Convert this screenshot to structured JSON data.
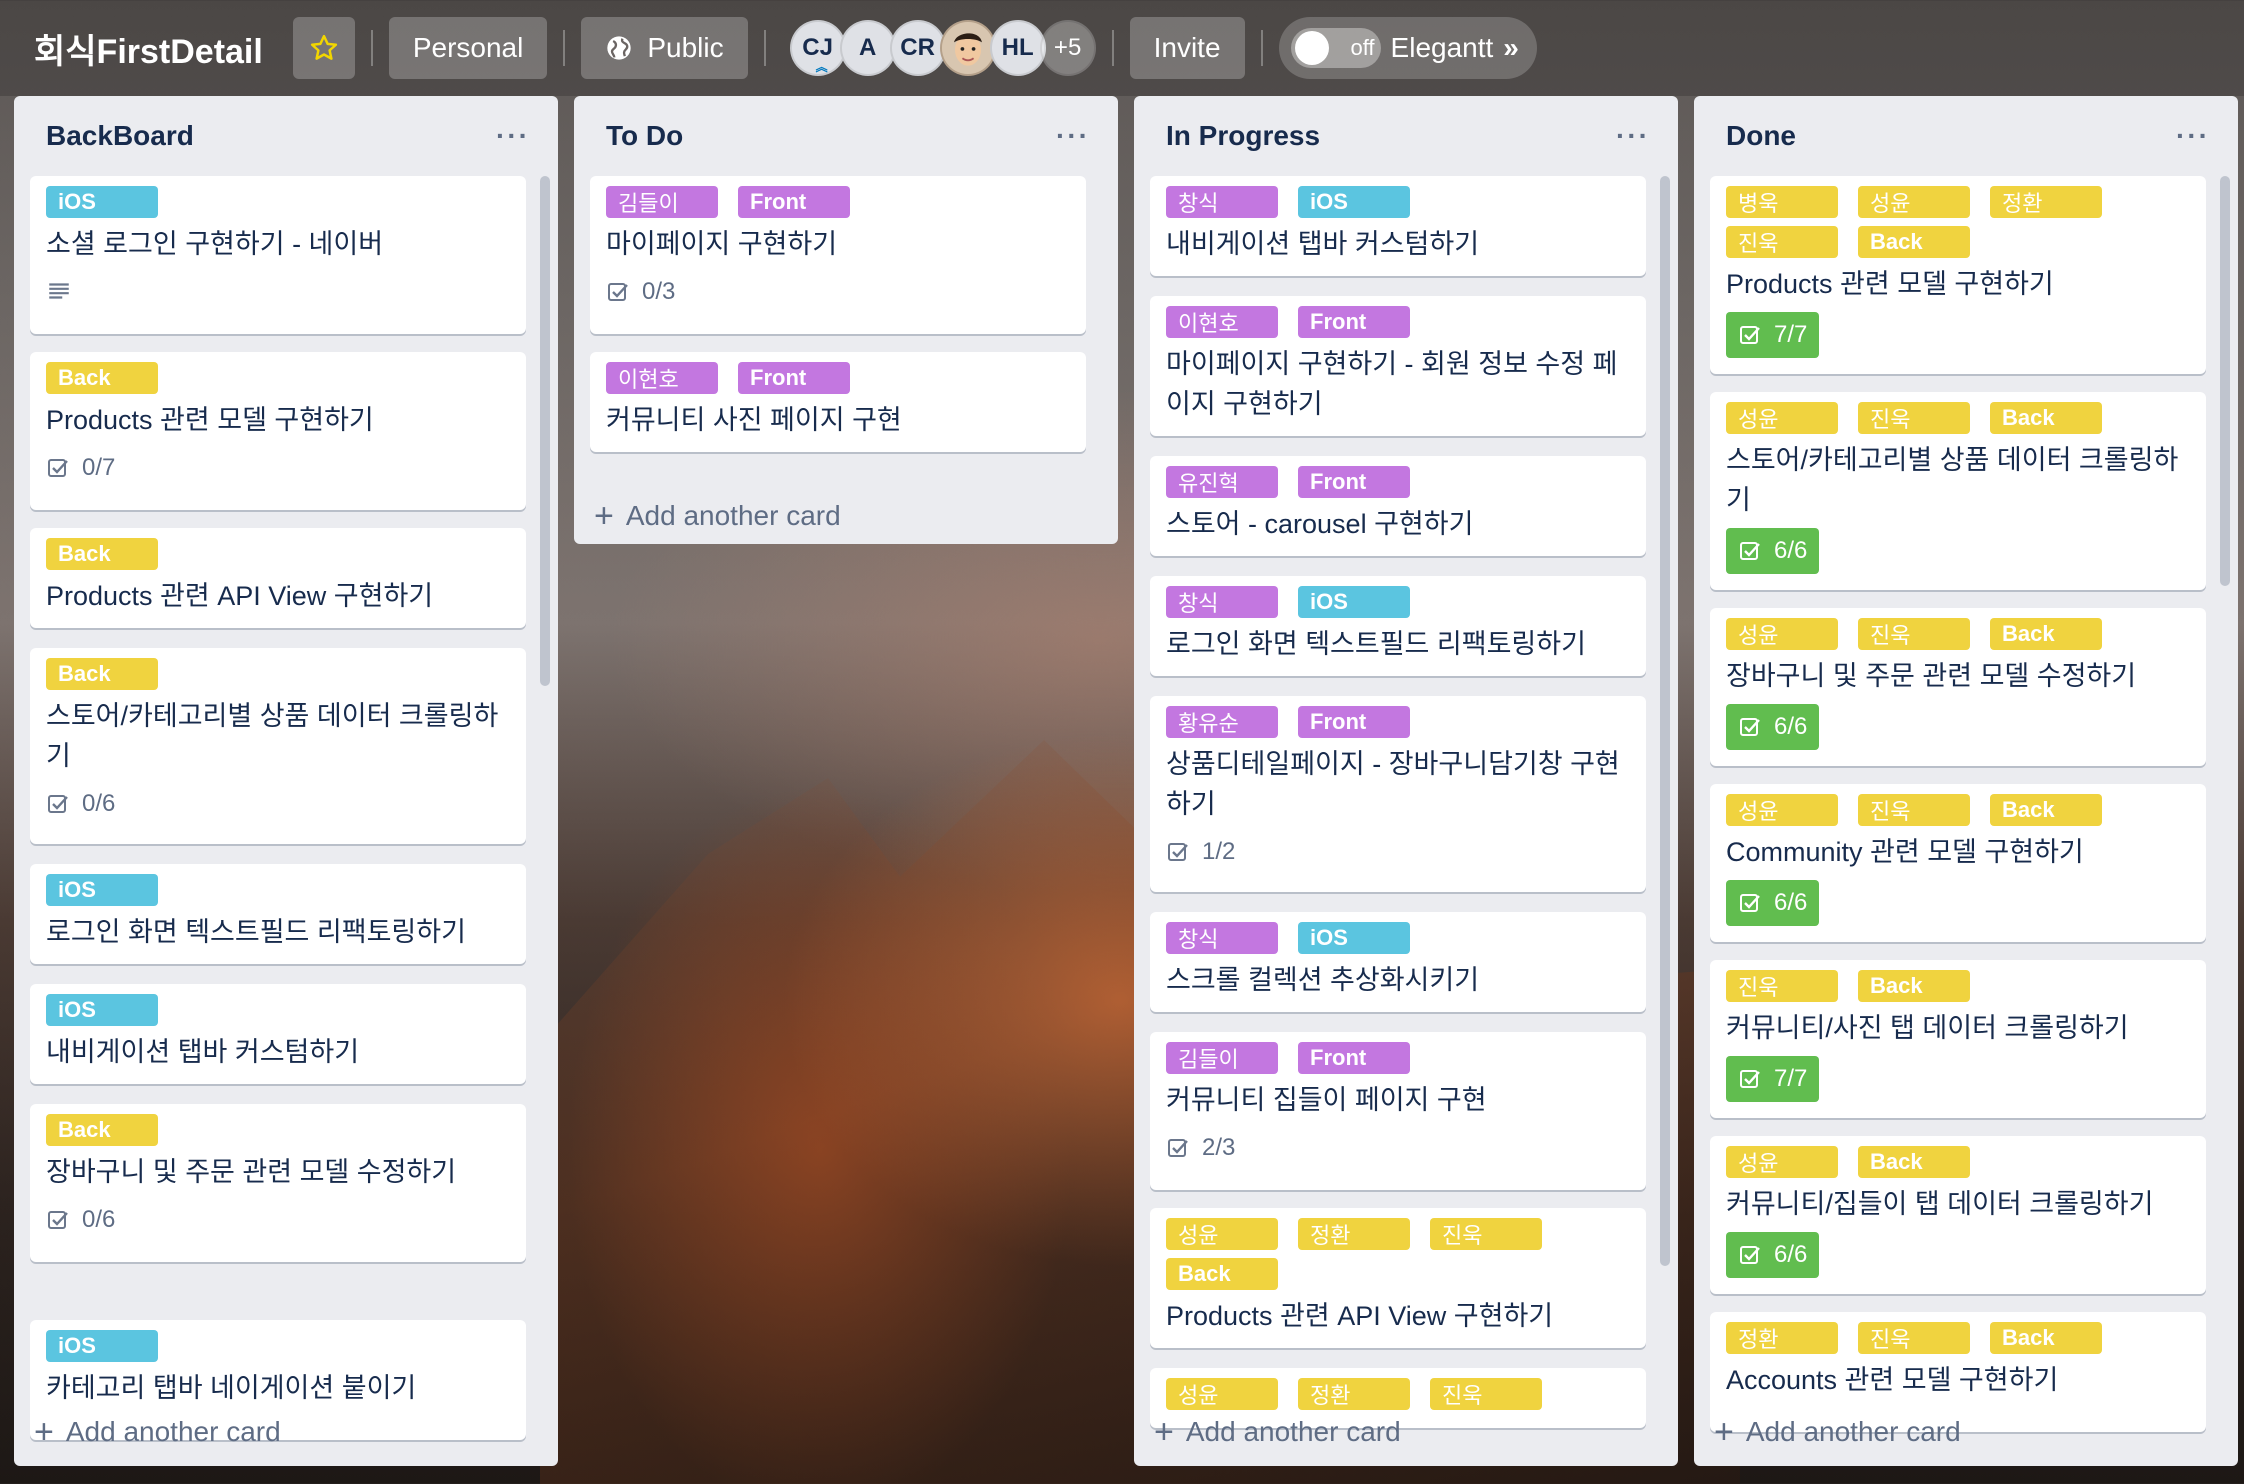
{
  "header": {
    "title": "회식FirstDetail",
    "personal_label": "Personal",
    "public_label": "Public",
    "members": [
      "CJ",
      "A",
      "CR",
      "HL"
    ],
    "members_more": "+5",
    "invite_label": "Invite",
    "toggle_state": "off",
    "powerup_label": "Elegantt",
    "chevron": "»"
  },
  "add_card_label": "Add another card",
  "lists": [
    {
      "title": "BackBoard",
      "cards": [
        {
          "labels": [
            "iOS"
          ],
          "title": "소셜 로그인 구현하기 - 네이버",
          "description_icon": true
        },
        {
          "labels": [
            "Back"
          ],
          "title": "Products 관련 모델 구현하기",
          "checklist": "0/7"
        },
        {
          "labels": [
            "Back"
          ],
          "title": "Products 관련 API View 구현하기"
        },
        {
          "labels": [
            "Back"
          ],
          "title": "스토어/카테고리별 상품 데이터 크롤링하기",
          "checklist": "0/6"
        },
        {
          "labels": [
            "iOS"
          ],
          "title": "로그인 화면 텍스트필드 리팩토링하기"
        },
        {
          "labels": [
            "iOS"
          ],
          "title": "내비게이션 탭바 커스텀하기"
        },
        {
          "labels": [
            "Back"
          ],
          "title": "장바구니 및 주문 관련 모델 수정하기",
          "checklist": "0/6"
        },
        {
          "labels": [
            "iOS"
          ],
          "title": "카테고리 탭바 네이게이션 붙이기"
        }
      ]
    },
    {
      "title": "To Do",
      "cards": [
        {
          "labels": [
            "김들이",
            "Front"
          ],
          "title": "마이페이지 구현하기",
          "checklist": "0/3"
        },
        {
          "labels": [
            "이현호",
            "Front"
          ],
          "title": "커뮤니티 사진 페이지 구현"
        }
      ]
    },
    {
      "title": "In Progress",
      "cards": [
        {
          "labels": [
            "창식",
            "iOS"
          ],
          "title": "내비게이션 탭바 커스텀하기"
        },
        {
          "labels": [
            "이현호",
            "Front"
          ],
          "title": "마이페이지 구현하기 - 회원 정보 수정 페이지 구현하기"
        },
        {
          "labels": [
            "유진혁",
            "Front"
          ],
          "title": "스토어 - carousel 구현하기"
        },
        {
          "labels": [
            "창식",
            "iOS"
          ],
          "title": "로그인 화면 텍스트필드 리팩토링하기"
        },
        {
          "labels": [
            "황유순",
            "Front"
          ],
          "title": "상품디테일페이지 - 장바구니담기창 구현하기",
          "checklist": "1/2"
        },
        {
          "labels": [
            "창식",
            "iOS"
          ],
          "title": "스크롤 컬렉션 추상화시키기"
        },
        {
          "labels": [
            "김들이",
            "Front"
          ],
          "title": "커뮤니티 집들이 페이지 구현",
          "checklist": "2/3"
        },
        {
          "labels": [
            "성윤",
            "정환",
            "진욱",
            "Back"
          ],
          "title": "Products 관련 API View 구현하기"
        },
        {
          "labels": [
            "성윤",
            "정환",
            "진욱"
          ],
          "title": ""
        }
      ]
    },
    {
      "title": "Done",
      "cards": [
        {
          "labels": [
            "병욱",
            "성윤",
            "정환",
            "진욱",
            "Back"
          ],
          "title": "Products 관련 모델 구현하기",
          "checklist": "7/7"
        },
        {
          "labels": [
            "성윤",
            "진욱",
            "Back"
          ],
          "title": "스토어/카테고리별 상품 데이터 크롤링하기",
          "checklist": "6/6"
        },
        {
          "labels": [
            "성윤",
            "진욱",
            "Back"
          ],
          "title": "장바구니 및 주문 관련 모델 수정하기",
          "checklist": "6/6"
        },
        {
          "labels": [
            "성윤",
            "진욱",
            "Back"
          ],
          "title": "Community 관련 모델 구현하기",
          "checklist": "6/6"
        },
        {
          "labels": [
            "진욱",
            "Back"
          ],
          "title": "커뮤니티/사진 탭 데이터 크롤링하기",
          "checklist": "7/7"
        },
        {
          "labels": [
            "성윤",
            "Back"
          ],
          "title": "커뮤니티/집들이 탭 데이터 크롤링하기",
          "checklist": "6/6"
        },
        {
          "labels": [
            "정환",
            "진욱",
            "Back"
          ],
          "title": "Accounts 관련 모델 구현하기"
        }
      ]
    }
  ],
  "colors": {
    "ios": "#5bc5e0",
    "back": "#f0d33f",
    "front": "#c377e0",
    "complete": "#61bd4f"
  }
}
